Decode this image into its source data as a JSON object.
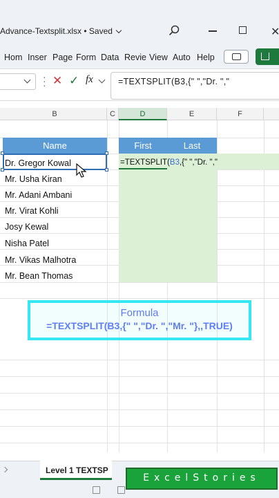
{
  "window": {
    "file_title": "Advance-Textsplit.xlsx • Saved",
    "close_glyph": "✕"
  },
  "ribbon": {
    "tabs": [
      "Hom",
      "Inser",
      "Page",
      "Form",
      "Data",
      "Revie",
      "View",
      "Auto",
      "Help"
    ]
  },
  "formula_bar": {
    "name_box": "",
    "cancel_glyph": "✕",
    "enter_glyph": "✓",
    "fx_label": "fx",
    "formula": "=TEXTSPLIT(B3,{\" \",\"Dr. \",\""
  },
  "columns": [
    "B",
    "C",
    "D",
    "E",
    "F"
  ],
  "table": {
    "header_name": "Name",
    "header_first": "First",
    "header_last": "Last",
    "names": [
      "Dr. Gregor Kowal",
      "Mr. Usha Kiran",
      "Mr. Adani Ambani",
      "Mr. Virat Kohli",
      "Josy Kewal",
      "Nisha Patel",
      "Mr. Vikas Malhotra",
      "Mr. Bean Thomas"
    ]
  },
  "editing_cell": {
    "prefix": "=TEXTSPLIT(",
    "ref": "B3",
    "suffix": ",{\" \",\"Dr. \",\""
  },
  "banner": {
    "title": "Formula",
    "formula": "=TEXTSPLIT(B3,{\" \",\"Dr. \",\"Mr. \"},,TRUE)"
  },
  "sheet_tabs": {
    "active": "Level 1 TEXTSP"
  },
  "brand": {
    "text": "ExcelStories"
  },
  "colors": {
    "accent_green": "#1e7a3c",
    "table_header": "#5b9bd5",
    "spill_fill": "#dbf0d4",
    "banner_border": "#34e7f0",
    "banner_text": "#5f7ef5",
    "brand_green": "#1aa33a"
  }
}
